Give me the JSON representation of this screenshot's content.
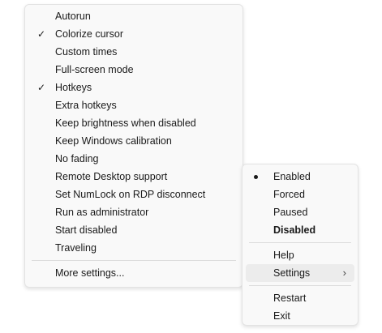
{
  "settings_menu": {
    "items": [
      {
        "label": "Autorun",
        "checked": false
      },
      {
        "label": "Colorize cursor",
        "checked": true
      },
      {
        "label": "Custom times",
        "checked": false
      },
      {
        "label": "Full-screen mode",
        "checked": false
      },
      {
        "label": "Hotkeys",
        "checked": true
      },
      {
        "label": "Extra hotkeys",
        "checked": false
      },
      {
        "label": "Keep brightness when disabled",
        "checked": false
      },
      {
        "label": "Keep Windows calibration",
        "checked": false
      },
      {
        "label": "No fading",
        "checked": false
      },
      {
        "label": "Remote Desktop support",
        "checked": false
      },
      {
        "label": "Set NumLock on RDP disconnect",
        "checked": false
      },
      {
        "label": "Run as administrator",
        "checked": false
      },
      {
        "label": "Start disabled",
        "checked": false
      },
      {
        "label": "Traveling",
        "checked": false
      }
    ],
    "more_settings": "More settings..."
  },
  "main_menu": {
    "modes": [
      {
        "label": "Enabled",
        "selected": true
      },
      {
        "label": "Forced",
        "selected": false
      },
      {
        "label": "Paused",
        "selected": false
      },
      {
        "label": "Disabled",
        "selected": false,
        "bold": true
      }
    ],
    "help": "Help",
    "settings": "Settings",
    "restart": "Restart",
    "exit": "Exit"
  },
  "icons": {
    "check": "checkmark-icon",
    "bullet": "radio-bullet-icon",
    "submenu": "chevron-right-icon"
  }
}
